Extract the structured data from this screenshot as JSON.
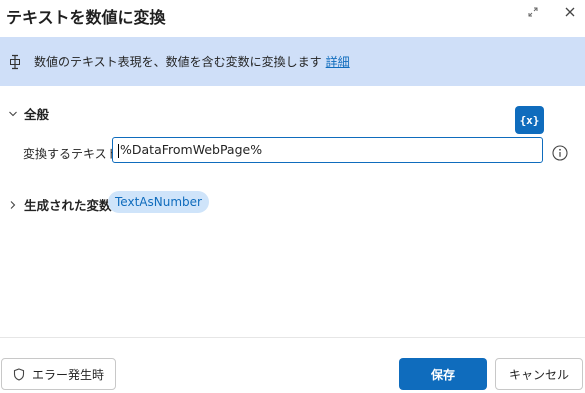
{
  "dialog": {
    "title": "テキストを数値に変換"
  },
  "info": {
    "description": "数値のテキスト表現を、数値を含む変数に変換します",
    "link": "詳細"
  },
  "general": {
    "header": "全般",
    "field_label": "変換するテキスト:",
    "field_value": "%DataFromWebPage%",
    "var_button": "{x}"
  },
  "variables": {
    "header": "生成された変数",
    "chip": "TextAsNumber"
  },
  "footer": {
    "error_button": "エラー発生時",
    "save_button": "保存",
    "cancel_button": "キャンセル"
  },
  "colors": {
    "accent": "#0f6cbd",
    "info_bar": "#cfdff8",
    "chip_bg": "#cfe4fa"
  }
}
